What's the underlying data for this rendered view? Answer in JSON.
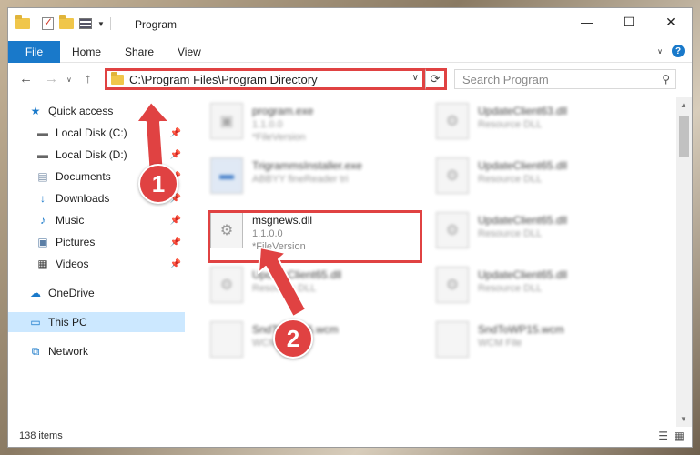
{
  "window": {
    "title": "Program"
  },
  "ribbon": {
    "tabs": [
      "File",
      "Home",
      "Share",
      "View"
    ]
  },
  "nav": {
    "address": "C:\\Program Files\\Program Directory",
    "search_placeholder": "Search Program"
  },
  "sidebar": {
    "items": [
      {
        "label": "Quick access",
        "icon": "star-icon"
      },
      {
        "label": "Local Disk (C:)",
        "icon": "drive-icon",
        "pinned": true
      },
      {
        "label": "Local Disk (D:)",
        "icon": "drive-icon",
        "pinned": true
      },
      {
        "label": "Documents",
        "icon": "documents-icon",
        "pinned": true
      },
      {
        "label": "Downloads",
        "icon": "download-icon",
        "pinned": true
      },
      {
        "label": "Music",
        "icon": "music-icon",
        "pinned": true
      },
      {
        "label": "Pictures",
        "icon": "pictures-icon",
        "pinned": true
      },
      {
        "label": "Videos",
        "icon": "videos-icon",
        "pinned": true
      },
      {
        "label": "OneDrive",
        "icon": "cloud-icon"
      },
      {
        "label": "This PC",
        "icon": "monitor-icon",
        "selected": true
      },
      {
        "label": "Network",
        "icon": "network-icon"
      }
    ]
  },
  "files": {
    "left": [
      {
        "name": "program.exe",
        "line1": "1.1.0.0",
        "line2": "*FileVersion"
      },
      {
        "name": "TrigrammsInstaller.exe",
        "line1": "ABBYY fineReader tri"
      },
      {
        "name": "msgnews.dll",
        "line1": "1.1.0.0",
        "line2": "*FileVersion"
      },
      {
        "name": "UpdateClient65.dll",
        "line1": "Resource DLL"
      },
      {
        "name": "SndToWP16.wcm",
        "line1": "WCM File"
      }
    ],
    "right": [
      {
        "name": "UpdateClient63.dll",
        "line1": "Resource DLL"
      },
      {
        "name": "UpdateClient65.dll",
        "line1": "Resource DLL"
      },
      {
        "name": "UpdateClient65.dll",
        "line1": "Resource DLL"
      },
      {
        "name": "UpdateClient65.dll",
        "line1": "Resource DLL"
      },
      {
        "name": "SndToWP15.wcm",
        "line1": "WCM File"
      }
    ]
  },
  "status": {
    "count": "138 items"
  },
  "annotations": {
    "step1": "1",
    "step2": "2",
    "color": "#e04242"
  }
}
